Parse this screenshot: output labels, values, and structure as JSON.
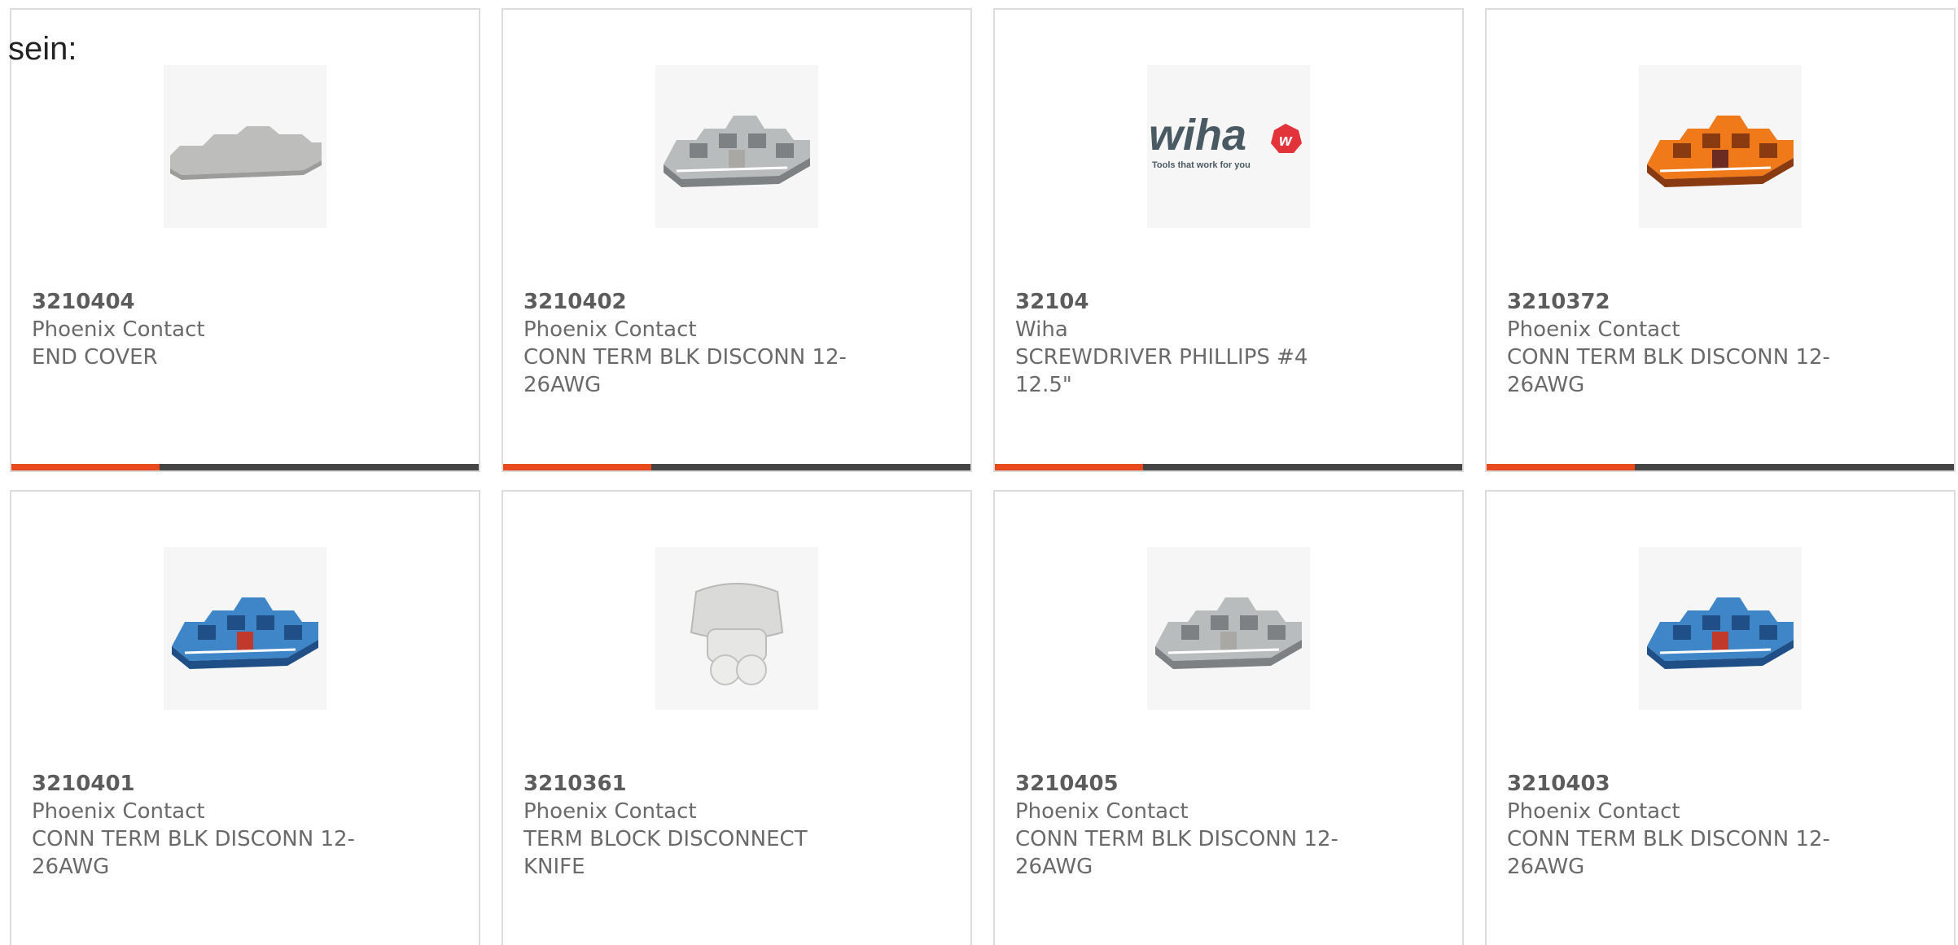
{
  "intro_text": "sein:",
  "accent_color": "#e8491d",
  "products": [
    {
      "part_number": "3210404",
      "manufacturer": "Phoenix Contact",
      "description": "END COVER",
      "image": "gray-end-cover"
    },
    {
      "part_number": "3210402",
      "manufacturer": "Phoenix Contact",
      "description": "CONN TERM BLK DISCONN 12-26AWG",
      "image": "gray-terminal-block"
    },
    {
      "part_number": "32104",
      "manufacturer": "Wiha",
      "description": "SCREWDRIVER PHILLIPS #4 12.5\"",
      "image": "wiha-logo",
      "logo_text": "wiha",
      "logo_tagline": "Tools that work for you"
    },
    {
      "part_number": "3210372",
      "manufacturer": "Phoenix Contact",
      "description": "CONN TERM BLK DISCONN 12-26AWG",
      "image": "orange-terminal-block"
    },
    {
      "part_number": "3210401",
      "manufacturer": "Phoenix Contact",
      "description": "CONN TERM BLK DISCONN 12-26AWG",
      "image": "blue-terminal-block"
    },
    {
      "part_number": "3210361",
      "manufacturer": "Phoenix Contact",
      "description": "TERM BLOCK DISCONNECT KNIFE",
      "image": "gray-disconnect-knife"
    },
    {
      "part_number": "3210405",
      "manufacturer": "Phoenix Contact",
      "description": "CONN TERM BLK DISCONN 12-26AWG",
      "image": "gray-terminal-block"
    },
    {
      "part_number": "3210403",
      "manufacturer": "Phoenix Contact",
      "description": "CONN TERM BLK DISCONN 12-26AWG",
      "image": "blue-terminal-block"
    }
  ]
}
